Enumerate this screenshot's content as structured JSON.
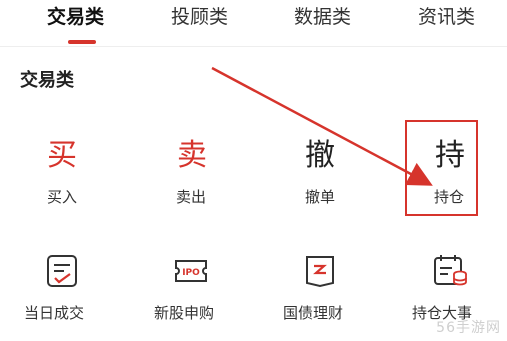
{
  "tabs": [
    {
      "label": "交易类",
      "active": true
    },
    {
      "label": "投顾类",
      "active": false
    },
    {
      "label": "数据类",
      "active": false
    },
    {
      "label": "资讯类",
      "active": false
    }
  ],
  "section_title": "交易类",
  "row1": [
    {
      "glyph": "买",
      "label": "买入",
      "icon": "buy-icon"
    },
    {
      "glyph": "卖",
      "label": "卖出",
      "icon": "sell-icon"
    },
    {
      "glyph": "撤",
      "label": "撤单",
      "icon": "cancel-order-icon"
    },
    {
      "glyph": "持",
      "label": "持仓",
      "icon": "holdings-icon"
    }
  ],
  "row2": [
    {
      "label": "当日成交",
      "icon": "todays-trades-icon"
    },
    {
      "label": "新股申购",
      "icon": "ipo-subscription-icon",
      "icon_text": "IPO"
    },
    {
      "label": "国债理财",
      "icon": "treasury-bond-icon"
    },
    {
      "label": "持仓大事",
      "icon": "holdings-events-icon"
    }
  ],
  "watermark": "56手游网",
  "colors": {
    "accent": "#d6342c",
    "text": "#222222"
  }
}
